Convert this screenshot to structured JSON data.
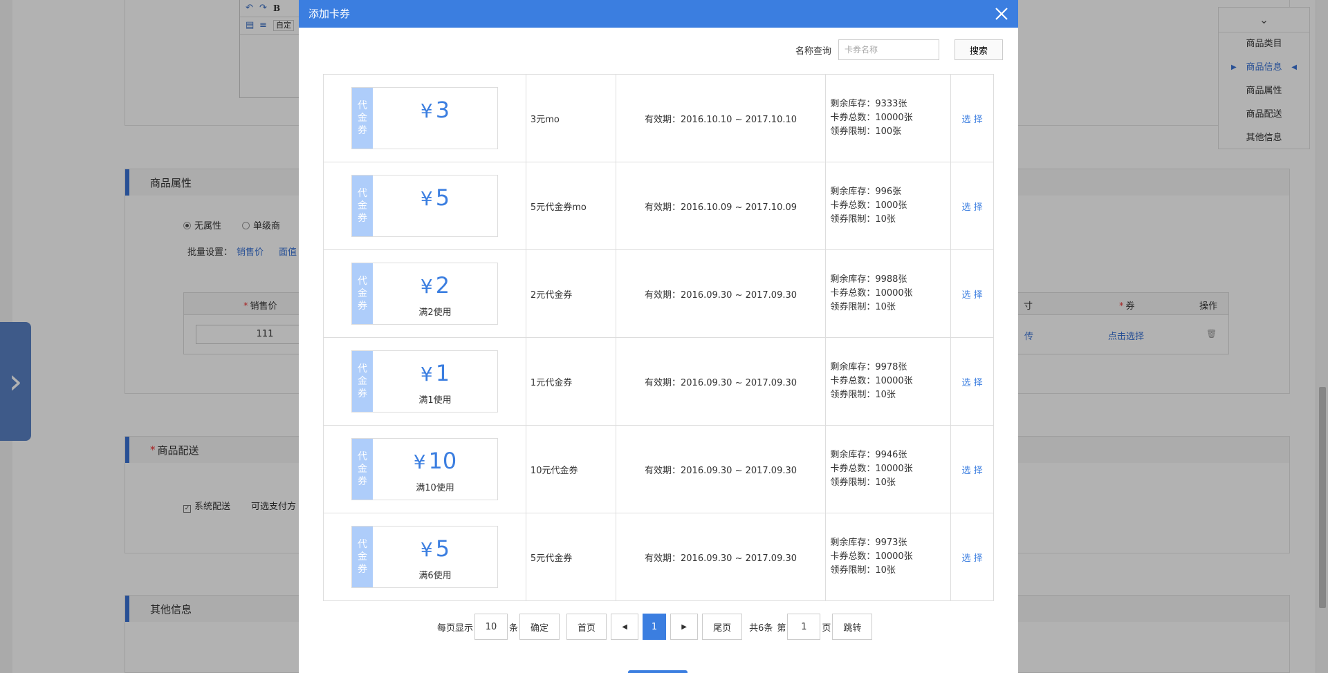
{
  "background": {
    "toolbar": {
      "bold": "B",
      "select_text": "自定"
    },
    "attr_section": {
      "title": "商品属性",
      "radio_none": "无属性",
      "radio_single": "单级商",
      "batch_label": "批量设置：",
      "batch_link_price": "销售价",
      "batch_link_face": "面值",
      "col_price": "销售价",
      "col_partial": "寸",
      "col_coupon": "券",
      "col_op": "操作",
      "price_value": "111",
      "partial_link": "传",
      "pick_link": "点击选择"
    },
    "ship_section": {
      "title": "商品配送",
      "system_ship": "系统配送",
      "pay_label": "可选支付方"
    },
    "other_section": {
      "title": "其他信息"
    },
    "side_nav": {
      "items": [
        "商品类目",
        "商品信息",
        "商品属性",
        "商品配送",
        "其他信息"
      ],
      "active_index": 1
    }
  },
  "modal": {
    "title": "添加卡券",
    "search": {
      "label": "名称查询",
      "placeholder": "卡券名称",
      "button": "搜索"
    },
    "coupons": [
      {
        "tag": "代金券",
        "amount": "3",
        "condition": "",
        "name": "3元mo",
        "validity": "有效期：2016.10.10 ~ 2017.10.10",
        "stock": "剩余库存：9333张",
        "total": "卡券总数：10000张",
        "limit": "领券限制：100张",
        "action": "选 择"
      },
      {
        "tag": "代金券",
        "amount": "5",
        "condition": "",
        "name": "5元代金券mo",
        "validity": "有效期：2016.10.09 ~ 2017.10.09",
        "stock": "剩余库存：996张",
        "total": "卡券总数：1000张",
        "limit": "领券限制：10张",
        "action": "选 择"
      },
      {
        "tag": "代金券",
        "amount": "2",
        "condition": "满2使用",
        "name": "2元代金券",
        "validity": "有效期：2016.09.30 ~ 2017.09.30",
        "stock": "剩余库存：9988张",
        "total": "卡券总数：10000张",
        "limit": "领券限制：10张",
        "action": "选 择"
      },
      {
        "tag": "代金券",
        "amount": "1",
        "condition": "满1使用",
        "name": "1元代金券",
        "validity": "有效期：2016.09.30 ~ 2017.09.30",
        "stock": "剩余库存：9978张",
        "total": "卡券总数：10000张",
        "limit": "领券限制：10张",
        "action": "选 择"
      },
      {
        "tag": "代金券",
        "amount": "10",
        "condition": "满10使用",
        "name": "10元代金券",
        "validity": "有效期：2016.09.30 ~ 2017.09.30",
        "stock": "剩余库存：9946张",
        "total": "卡券总数：10000张",
        "limit": "领券限制：10张",
        "action": "选 择"
      },
      {
        "tag": "代金券",
        "amount": "5",
        "condition": "满6使用",
        "name": "5元代金券",
        "validity": "有效期：2016.09.30 ~ 2017.09.30",
        "stock": "剩余库存：9973张",
        "total": "卡券总数：10000张",
        "limit": "领券限制：10张",
        "action": "选 择"
      }
    ],
    "pager": {
      "per_page_label": "每页显示",
      "per_page": "10",
      "per_page_unit": "条",
      "confirm": "确定",
      "first": "首页",
      "current": "1",
      "last": "尾页",
      "total": "共6条",
      "page_prefix": "第",
      "page_value": "1",
      "page_suffix": "页",
      "jump": "跳转"
    }
  },
  "colors": {
    "accent": "#3b7ee0",
    "tag_bg": "#aecdfa",
    "section_bar": "#3a73d6"
  }
}
